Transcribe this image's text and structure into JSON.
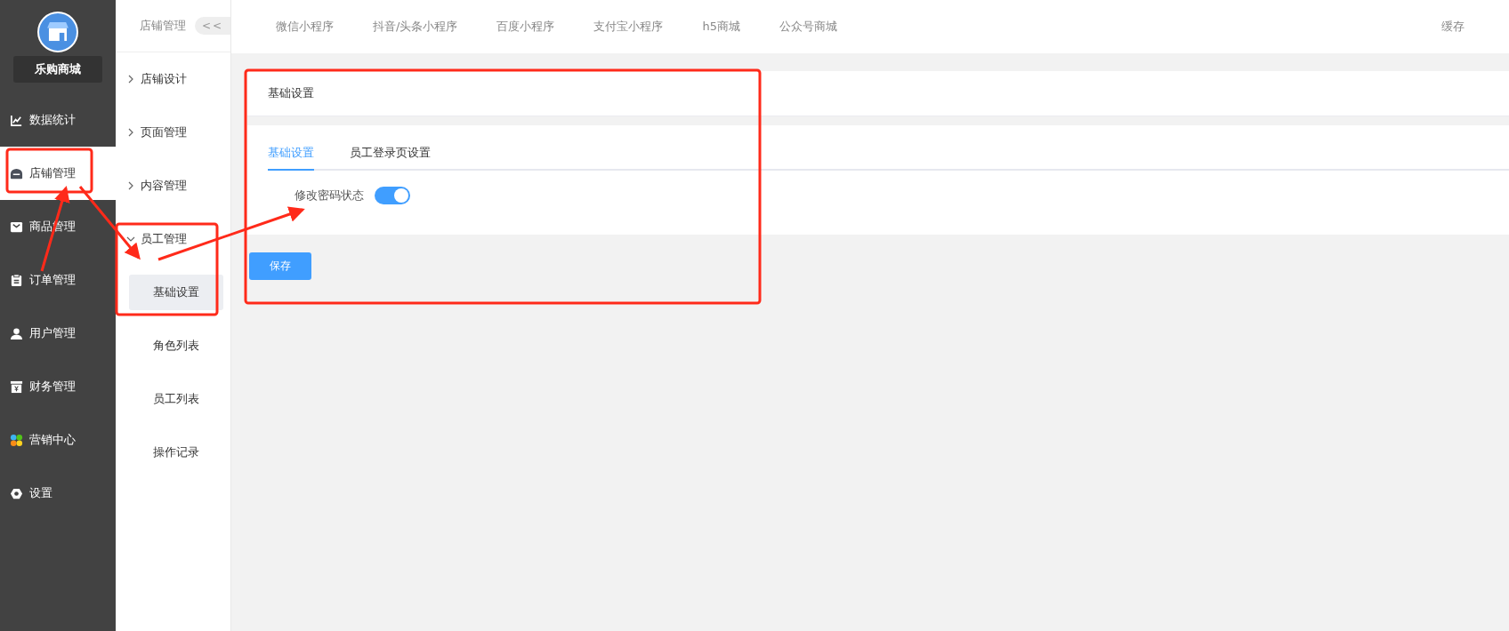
{
  "sidebar": {
    "brand": "乐购商城",
    "items": [
      {
        "label": "数据统计",
        "kind": "chart",
        "selected": false
      },
      {
        "label": "店铺管理",
        "kind": "store",
        "selected": true
      },
      {
        "label": "商品管理",
        "kind": "bag",
        "selected": false
      },
      {
        "label": "订单管理",
        "kind": "clipboard",
        "selected": false
      },
      {
        "label": "用户管理",
        "kind": "user",
        "selected": false
      },
      {
        "label": "财务管理",
        "kind": "wallet",
        "selected": false
      },
      {
        "label": "营销中心",
        "kind": "petals",
        "selected": false
      },
      {
        "label": "设置",
        "kind": "gear",
        "selected": false
      }
    ]
  },
  "subnav": {
    "title": "店铺管理",
    "collapse": "<<",
    "items": [
      {
        "label": "店铺设计",
        "expanded": false
      },
      {
        "label": "页面管理",
        "expanded": false
      },
      {
        "label": "内容管理",
        "expanded": false
      },
      {
        "label": "员工管理",
        "expanded": true,
        "children": [
          {
            "label": "基础设置",
            "selected": true
          },
          {
            "label": "角色列表",
            "selected": false
          },
          {
            "label": "员工列表",
            "selected": false
          },
          {
            "label": "操作记录",
            "selected": false
          }
        ]
      }
    ]
  },
  "topbar": {
    "tabs": [
      "微信小程序",
      "抖音/头条小程序",
      "百度小程序",
      "支付宝小程序",
      "h5商城",
      "公众号商城"
    ],
    "cache": "缓存"
  },
  "panel": {
    "title": "基础设置",
    "tabs": [
      {
        "label": "基础设置",
        "selected": true
      },
      {
        "label": "员工登录页设置",
        "selected": false
      }
    ],
    "fields": [
      {
        "label": "修改密码状态",
        "on": true
      }
    ],
    "save_button": "保存"
  }
}
